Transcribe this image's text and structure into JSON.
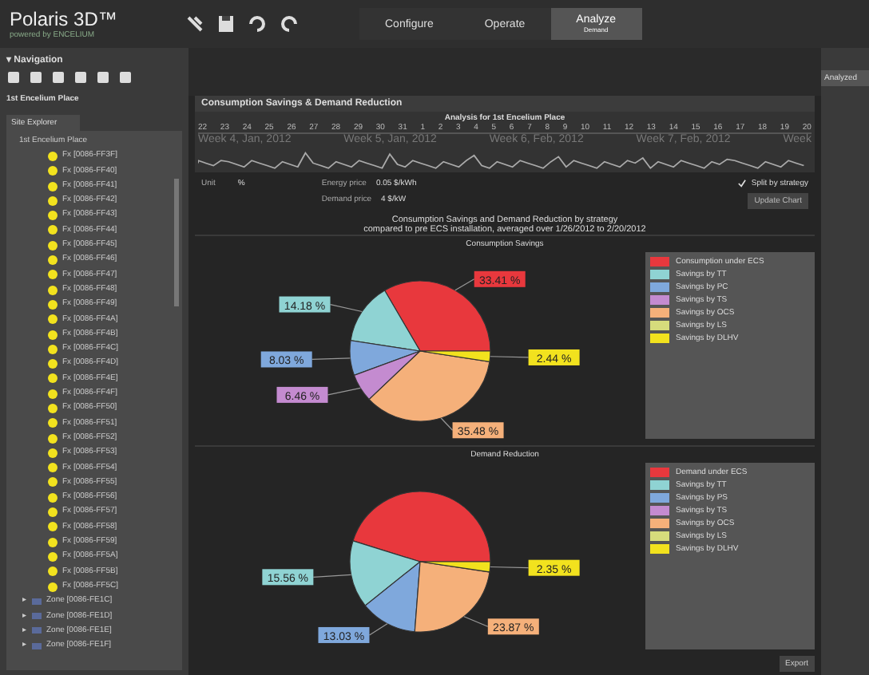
{
  "app": {
    "name": "Polaris 3D™",
    "tagline": "powered by ENCELIUM"
  },
  "mode_tabs": [
    {
      "label": "Configure",
      "selected": false
    },
    {
      "label": "Operate",
      "selected": false
    },
    {
      "label": "Analyze",
      "sub": "Demand",
      "selected": true
    }
  ],
  "navigation": {
    "title": "▾ Navigation",
    "site": "1st Encelium Place"
  },
  "site_explorer": {
    "tab": "Site Explorer",
    "root": "1st Encelium Place",
    "children": [
      {
        "kind": "fixture",
        "label": "Fx [0086-FF3F]"
      },
      {
        "kind": "fixture",
        "label": "Fx [0086-FF40]"
      },
      {
        "kind": "fixture",
        "label": "Fx [0086-FF41]"
      },
      {
        "kind": "fixture",
        "label": "Fx [0086-FF42]"
      },
      {
        "kind": "fixture",
        "label": "Fx [0086-FF43]"
      },
      {
        "kind": "fixture",
        "label": "Fx [0086-FF44]"
      },
      {
        "kind": "fixture",
        "label": "Fx [0086-FF45]"
      },
      {
        "kind": "fixture",
        "label": "Fx [0086-FF46]"
      },
      {
        "kind": "fixture",
        "label": "Fx [0086-FF47]"
      },
      {
        "kind": "fixture",
        "label": "Fx [0086-FF48]"
      },
      {
        "kind": "fixture",
        "label": "Fx [0086-FF49]"
      },
      {
        "kind": "fixture",
        "label": "Fx [0086-FF4A]"
      },
      {
        "kind": "fixture",
        "label": "Fx [0086-FF4B]"
      },
      {
        "kind": "fixture",
        "label": "Fx [0086-FF4C]"
      },
      {
        "kind": "fixture",
        "label": "Fx [0086-FF4D]"
      },
      {
        "kind": "fixture",
        "label": "Fx [0086-FF4E]"
      },
      {
        "kind": "fixture",
        "label": "Fx [0086-FF4F]"
      },
      {
        "kind": "fixture",
        "label": "Fx [0086-FF50]"
      },
      {
        "kind": "fixture",
        "label": "Fx [0086-FF51]"
      },
      {
        "kind": "fixture",
        "label": "Fx [0086-FF52]"
      },
      {
        "kind": "fixture",
        "label": "Fx [0086-FF53]"
      },
      {
        "kind": "fixture",
        "label": "Fx [0086-FF54]"
      },
      {
        "kind": "fixture",
        "label": "Fx [0086-FF55]"
      },
      {
        "kind": "fixture",
        "label": "Fx [0086-FF56]"
      },
      {
        "kind": "fixture",
        "label": "Fx [0086-FF57]"
      },
      {
        "kind": "fixture",
        "label": "Fx [0086-FF58]"
      },
      {
        "kind": "fixture",
        "label": "Fx [0086-FF59]"
      },
      {
        "kind": "fixture",
        "label": "Fx [0086-FF5A]"
      },
      {
        "kind": "fixture",
        "label": "Fx [0086-FF5B]"
      },
      {
        "kind": "fixture",
        "label": "Fx [0086-FF5C]"
      },
      {
        "kind": "zone",
        "toggle": "▸",
        "label": "Zone [0086-FE1C]"
      },
      {
        "kind": "zone",
        "toggle": "▸",
        "label": "Zone [0086-FE1D]"
      },
      {
        "kind": "zone",
        "toggle": "▸",
        "label": "Zone [0086-FE1E]"
      },
      {
        "kind": "zone",
        "toggle": "▸",
        "label": "Zone [0086-FE1F]"
      }
    ]
  },
  "right_panel": {
    "tab": "Analyzed"
  },
  "panel": {
    "title": "Consumption Savings & Demand Reduction",
    "timeline": {
      "title": "Analysis for 1st Encelium Place",
      "days": [
        "22",
        "23",
        "24",
        "25",
        "26",
        "27",
        "28",
        "29",
        "30",
        "31",
        "1",
        "2",
        "3",
        "4",
        "5",
        "6",
        "7",
        "8",
        "9",
        "10",
        "11",
        "12",
        "13",
        "14",
        "15",
        "16",
        "17",
        "18",
        "19",
        "20"
      ],
      "weeks": [
        "Week 4, Jan, 2012",
        "Week 5, Jan, 2012",
        "Week 6, Feb, 2012",
        "Week 7, Feb, 2012",
        "Week"
      ]
    },
    "unit": {
      "label": "Unit",
      "value": "%"
    },
    "energy_price": {
      "label": "Energy price",
      "value": "0.05 $/kWh"
    },
    "demand_price": {
      "label": "Demand price",
      "value": "4 $/kW"
    },
    "split_by_strategy": {
      "label": "Split by strategy",
      "checked": true
    },
    "update_button": "Update Chart",
    "heading": "Consumption Savings and Demand Reduction by strategy",
    "subheading": "compared to pre ECS installation, averaged over 1/26/2012 to 2/20/2012",
    "charts": [
      {
        "chart_data": {
          "type": "pie",
          "title": "Consumption Savings",
          "categories": [
            "Consumption under ECS",
            "Savings by TT",
            "Savings by PC",
            "Savings by TS",
            "Savings by OCS",
            "Savings by LS",
            "Savings by DLHV"
          ],
          "series": [
            {
              "values": [
                33.41,
                14.18,
                8.03,
                6.46,
                35.48,
                0,
                2.44
              ]
            }
          ],
          "legend": "right",
          "colors": [
            "#e8383d",
            "#8fd3d3",
            "#7fa8dc",
            "#c48bd0",
            "#f5b07a",
            "#d6dc7c",
            "#f2e21e"
          ],
          "value_labels": [
            "33.41 %",
            "14.18 %",
            "8.03 %",
            "6.46 %",
            "35.48 %",
            null,
            "2.44 %"
          ]
        }
      },
      {
        "chart_data": {
          "type": "pie",
          "title": "Demand Reduction",
          "categories": [
            "Demand under ECS",
            "Savings by TT",
            "Savings by PS",
            "Savings by TS",
            "Savings by OCS",
            "Savings by LS",
            "Savings by DLHV"
          ],
          "series": [
            {
              "values": [
                45.19,
                15.56,
                13.03,
                0,
                23.87,
                0,
                2.35
              ]
            }
          ],
          "legend": "right",
          "colors": [
            "#e8383d",
            "#8fd3d3",
            "#7fa8dc",
            "#c48bd0",
            "#f5b07a",
            "#d6dc7c",
            "#f2e21e"
          ],
          "value_labels": [
            null,
            "15.56 %",
            "13.03 %",
            null,
            "23.87 %",
            null,
            "2.35 %"
          ]
        }
      }
    ],
    "export_button": "Export"
  }
}
